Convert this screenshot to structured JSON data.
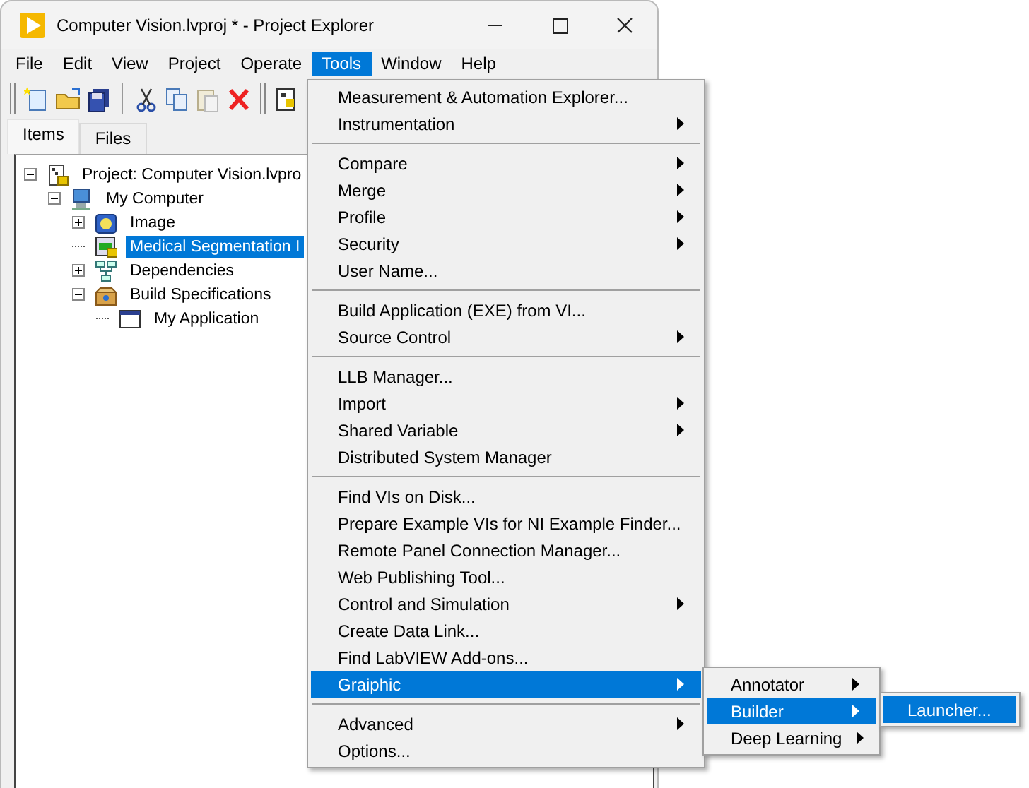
{
  "window": {
    "title": "Computer Vision.lvproj * - Project Explorer"
  },
  "menu_bar": [
    {
      "label": "File",
      "selected": false
    },
    {
      "label": "Edit",
      "selected": false
    },
    {
      "label": "View",
      "selected": false
    },
    {
      "label": "Project",
      "selected": false
    },
    {
      "label": "Operate",
      "selected": false
    },
    {
      "label": "Tools",
      "selected": true
    },
    {
      "label": "Window",
      "selected": false
    },
    {
      "label": "Help",
      "selected": false
    }
  ],
  "tabs": [
    {
      "label": "Items",
      "selected": true
    },
    {
      "label": "Files",
      "selected": false
    }
  ],
  "tree": [
    {
      "kind": "project",
      "label": "Project: Computer Vision.lvpro",
      "expanded": true,
      "selected": false,
      "children": [
        {
          "kind": "computer",
          "label": "My Computer",
          "expanded": true,
          "selected": false,
          "children": [
            {
              "kind": "library",
              "label": "Image",
              "expanded": false,
              "selected": false
            },
            {
              "kind": "vi",
              "label": "Medical Segmentation I",
              "selected": true
            },
            {
              "kind": "dependencies",
              "label": "Dependencies",
              "expanded": false,
              "selected": false
            },
            {
              "kind": "build",
              "label": "Build Specifications",
              "expanded": true,
              "selected": false,
              "children": [
                {
                  "kind": "application",
                  "label": "My Application",
                  "selected": false
                }
              ]
            }
          ]
        }
      ]
    }
  ],
  "tools_menu": [
    {
      "kind": "item",
      "label": "Measurement & Automation Explorer...",
      "submenu": false,
      "selected": false
    },
    {
      "kind": "item",
      "label": "Instrumentation",
      "submenu": true,
      "selected": false
    },
    {
      "kind": "separator"
    },
    {
      "kind": "item",
      "label": "Compare",
      "submenu": true,
      "selected": false
    },
    {
      "kind": "item",
      "label": "Merge",
      "submenu": true,
      "selected": false
    },
    {
      "kind": "item",
      "label": "Profile",
      "submenu": true,
      "selected": false
    },
    {
      "kind": "item",
      "label": "Security",
      "submenu": true,
      "selected": false
    },
    {
      "kind": "item",
      "label": "User Name...",
      "submenu": false,
      "selected": false
    },
    {
      "kind": "separator"
    },
    {
      "kind": "item",
      "label": "Build Application (EXE) from VI...",
      "submenu": false,
      "selected": false
    },
    {
      "kind": "item",
      "label": "Source Control",
      "submenu": true,
      "selected": false
    },
    {
      "kind": "separator"
    },
    {
      "kind": "item",
      "label": "LLB Manager...",
      "submenu": false,
      "selected": false
    },
    {
      "kind": "item",
      "label": "Import",
      "submenu": true,
      "selected": false
    },
    {
      "kind": "item",
      "label": "Shared Variable",
      "submenu": true,
      "selected": false
    },
    {
      "kind": "item",
      "label": "Distributed System Manager",
      "submenu": false,
      "selected": false
    },
    {
      "kind": "separator"
    },
    {
      "kind": "item",
      "label": "Find VIs on Disk...",
      "submenu": false,
      "selected": false
    },
    {
      "kind": "item",
      "label": "Prepare Example VIs for NI Example Finder...",
      "submenu": false,
      "selected": false
    },
    {
      "kind": "item",
      "label": "Remote Panel Connection Manager...",
      "submenu": false,
      "selected": false
    },
    {
      "kind": "item",
      "label": "Web Publishing Tool...",
      "submenu": false,
      "selected": false
    },
    {
      "kind": "item",
      "label": "Control and Simulation",
      "submenu": true,
      "selected": false
    },
    {
      "kind": "item",
      "label": "Create Data Link...",
      "submenu": false,
      "selected": false
    },
    {
      "kind": "item",
      "label": "Find LabVIEW Add-ons...",
      "submenu": false,
      "selected": false
    },
    {
      "kind": "item",
      "label": "Graiphic",
      "submenu": true,
      "selected": true
    },
    {
      "kind": "separator"
    },
    {
      "kind": "item",
      "label": "Advanced",
      "submenu": true,
      "selected": false
    },
    {
      "kind": "item",
      "label": "Options...",
      "submenu": false,
      "selected": false
    }
  ],
  "graiphic_menu": [
    {
      "label": "Annotator",
      "submenu": true,
      "selected": false
    },
    {
      "label": "Builder",
      "submenu": true,
      "selected": true
    },
    {
      "label": "Deep Learning",
      "submenu": true,
      "selected": false
    }
  ],
  "builder_menu": [
    {
      "label": "Launcher...",
      "submenu": false,
      "selected": true
    }
  ]
}
